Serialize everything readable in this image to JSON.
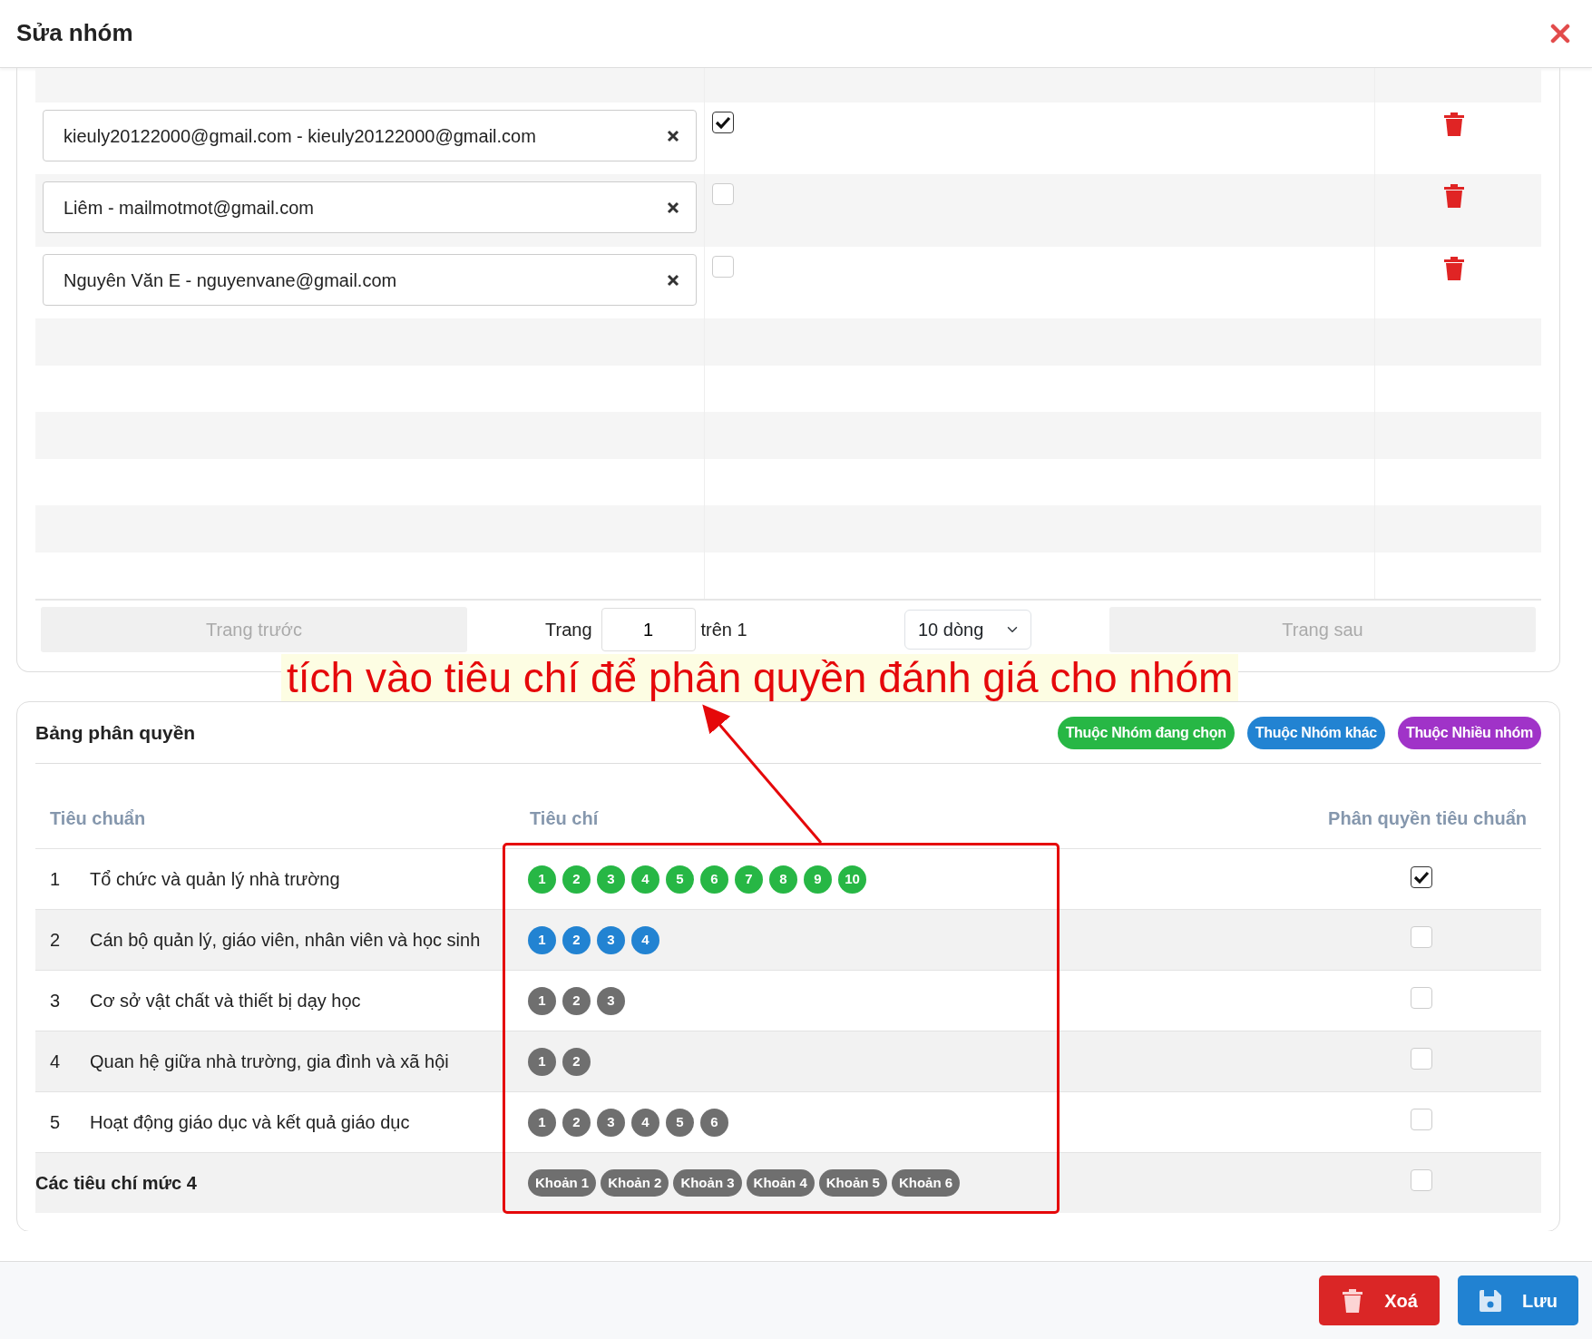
{
  "dialog": {
    "title": "Sửa nhóm"
  },
  "members": {
    "rows": [
      {
        "member": "kieuly20122000@gmail.com - kieuly20122000@gmail.com",
        "checked": true
      },
      {
        "member": "Liêm - mailmotmot@gmail.com",
        "checked": false
      },
      {
        "member": "Nguyên Văn E - nguyenvane@gmail.com",
        "checked": false
      }
    ]
  },
  "pagination": {
    "previous": {
      "label": "Trang trước",
      "disabled": true
    },
    "page_label": "Trang",
    "page": "1",
    "of_label": "trên 1",
    "page_size": "10 dòng",
    "next": {
      "label": "Trang sau",
      "disabled": true
    }
  },
  "annotation": {
    "text": "tích vào tiêu chí để phân quyền đánh giá cho nhóm"
  },
  "permissions": {
    "title": "Bảng phân quyền",
    "legend": [
      {
        "label": "Thuộc Nhóm đang chọn",
        "color": "#27b745"
      },
      {
        "label": "Thuộc Nhóm khác",
        "color": "#2283d2"
      },
      {
        "label": "Thuộc Nhiều nhóm",
        "color": "#a033c8"
      }
    ],
    "columns": [
      "Tiêu chuẩn",
      "Tiêu chí",
      "Phân quyền tiêu chuẩn"
    ],
    "rows": [
      {
        "kind": "standard",
        "number": "1",
        "name": "Tổ chức và quản lý nhà trường",
        "color": "#27b745",
        "criteria": [
          "1",
          "2",
          "3",
          "4",
          "5",
          "6",
          "7",
          "8",
          "9",
          "10"
        ],
        "checked": true
      },
      {
        "kind": "standard",
        "number": "2",
        "name": "Cán bộ quản lý, giáo viên, nhân viên và học sinh",
        "color": "#2283d2",
        "criteria": [
          "1",
          "2",
          "3",
          "4"
        ],
        "checked": false
      },
      {
        "kind": "standard",
        "number": "3",
        "name": "Cơ sở vật chất và thiết bị dạy học",
        "color": "#6f6f6f",
        "criteria": [
          "1",
          "2",
          "3"
        ],
        "checked": false
      },
      {
        "kind": "standard",
        "number": "4",
        "name": "Quan hệ giữa nhà trường, gia đình và xã hội",
        "color": "#6f6f6f",
        "criteria": [
          "1",
          "2"
        ],
        "checked": false
      },
      {
        "kind": "standard",
        "number": "5",
        "name": "Hoạt động giáo dục và kết quả giáo dục",
        "color": "#6f6f6f",
        "criteria": [
          "1",
          "2",
          "3",
          "4",
          "5",
          "6"
        ],
        "checked": false
      },
      {
        "kind": "level4",
        "name": "Các tiêu chí mức 4",
        "color": "#6f6f6f",
        "criteria": [
          "Khoản 1",
          "Khoản 2",
          "Khoản 3",
          "Khoản 4",
          "Khoản 5",
          "Khoản 6"
        ],
        "checked": false
      }
    ]
  },
  "footer": {
    "buttons": [
      {
        "kind": "delete",
        "label": "Xoá"
      },
      {
        "kind": "save",
        "label": "Lưu"
      }
    ]
  }
}
